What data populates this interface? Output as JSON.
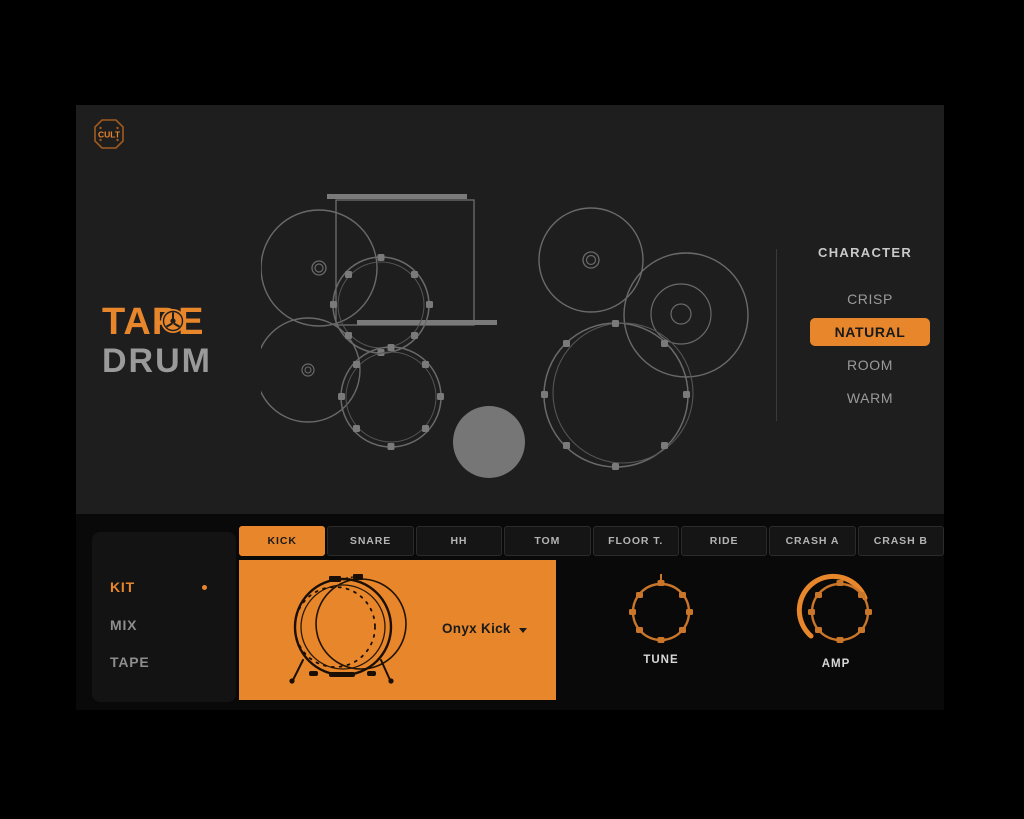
{
  "app": {
    "brand_badge": "CULT",
    "logo_line1": "TAPE",
    "logo_line2": "DRUM",
    "accent_color": "#e8862b",
    "panel_bg": "#1e1e1e",
    "bottom_bg": "#090909"
  },
  "character": {
    "title": "CHARACTER",
    "options": [
      {
        "label": "CRISP",
        "selected": false
      },
      {
        "label": "NATURAL",
        "selected": true
      },
      {
        "label": "ROOM",
        "selected": false
      },
      {
        "label": "WARM",
        "selected": false
      }
    ]
  },
  "sidebar": {
    "items": [
      {
        "label": "KIT",
        "active": true
      },
      {
        "label": "MIX",
        "active": false
      },
      {
        "label": "TAPE",
        "active": false
      }
    ]
  },
  "tabs": [
    {
      "label": "KICK",
      "active": true
    },
    {
      "label": "SNARE",
      "active": false
    },
    {
      "label": "HH",
      "active": false
    },
    {
      "label": "TOM",
      "active": false
    },
    {
      "label": "FLOOR T.",
      "active": false
    },
    {
      "label": "RIDE",
      "active": false
    },
    {
      "label": "CRASH A",
      "active": false
    },
    {
      "label": "CRASH B",
      "active": false
    }
  ],
  "kick_panel": {
    "preset_name": "Onyx Kick",
    "dropdown_icon": "chevron-down-icon"
  },
  "knobs": [
    {
      "label": "TUNE",
      "value_arc": 0
    },
    {
      "label": "AMP",
      "value_arc": 72
    }
  ],
  "kit_diagram": {
    "description": "top-down drum kit outline",
    "selected_piece": "kick"
  }
}
